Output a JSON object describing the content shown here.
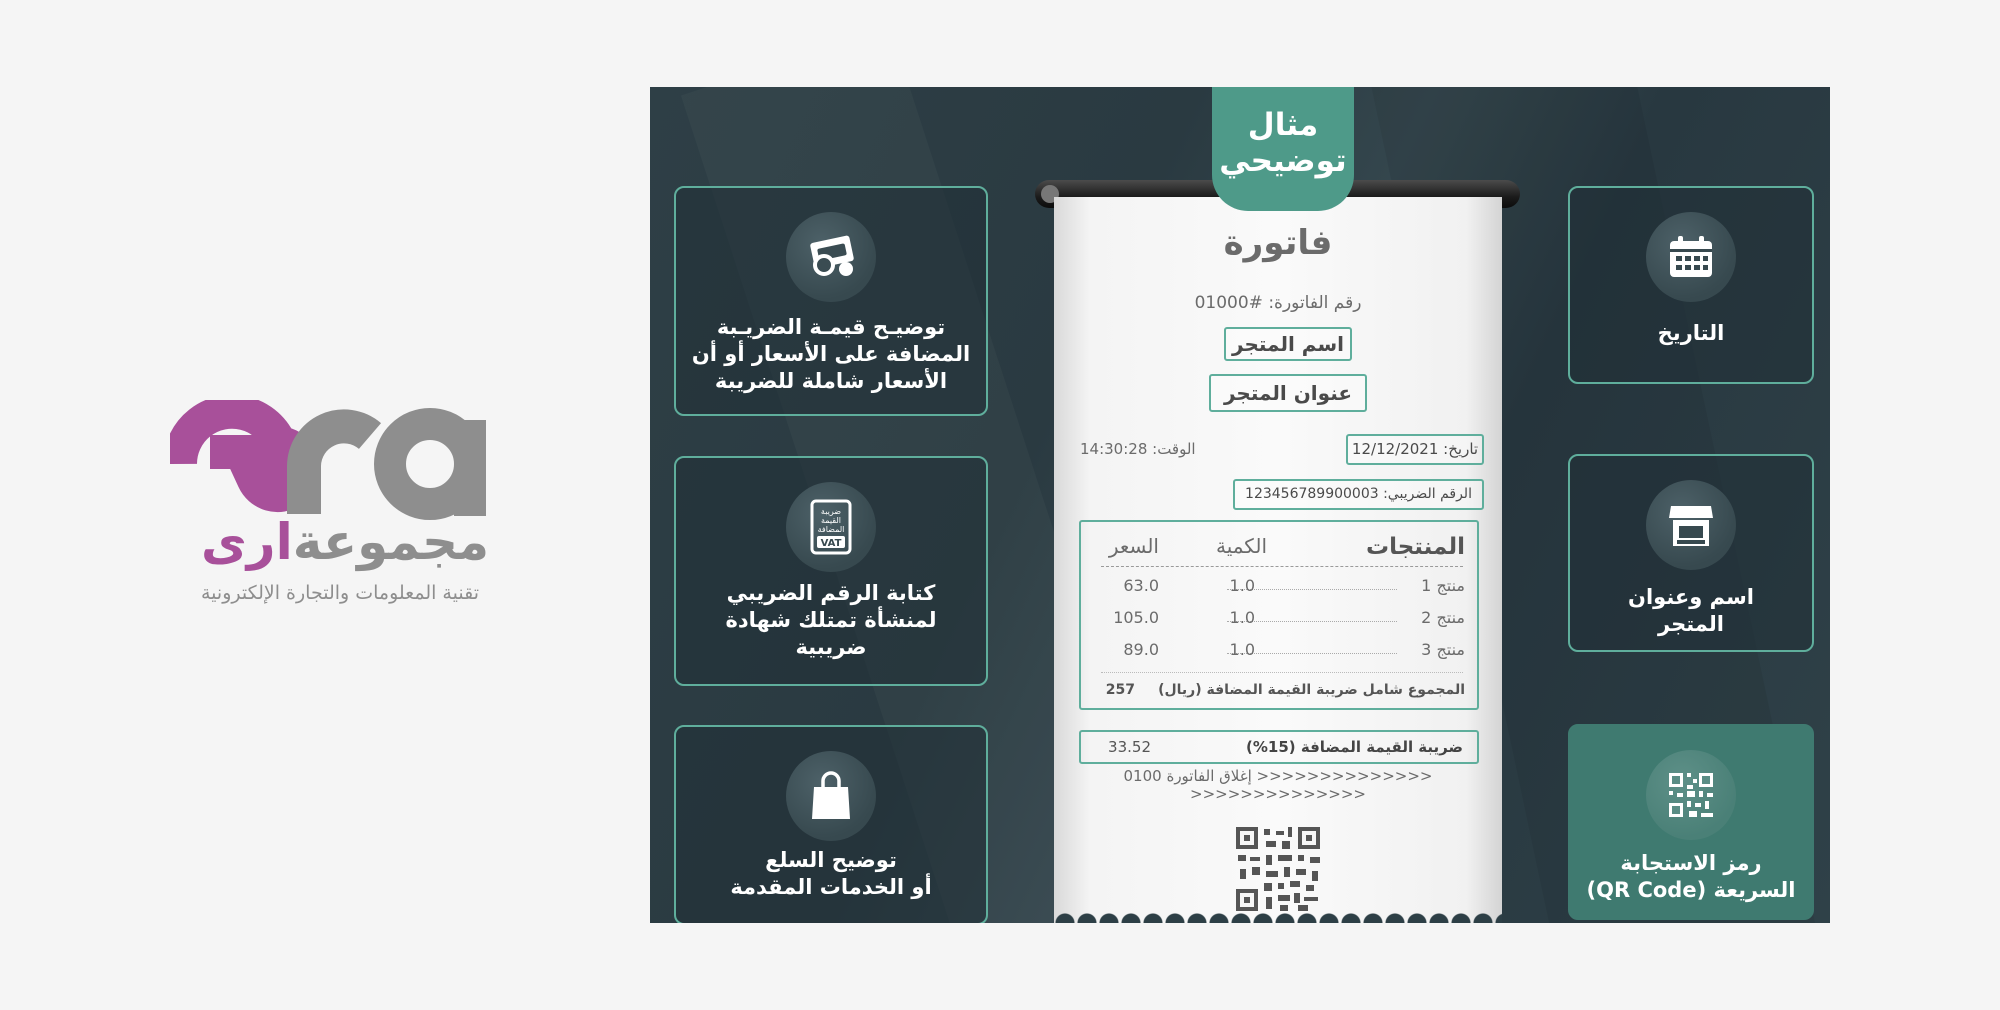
{
  "brand": {
    "latin": "era",
    "arabic_part1": "مجموعة",
    "arabic_part2": "ارى",
    "tagline": "تقنية المعلومات والتجارة الإلكترونية",
    "color_primary": "#a8509a",
    "color_secondary": "#8e8e8e"
  },
  "badge": {
    "line1": "مثال",
    "line2": "توضيحي"
  },
  "cards_left": [
    {
      "icon": "money-icon",
      "text_lines": [
        "توضيـح قيمـة الضريـبة",
        "المضافة على الأسعار أو أن",
        "الأسعار شاملة للضريبة"
      ]
    },
    {
      "icon": "vat-certificate-icon",
      "text_lines": [
        "كتابة الرقم الضريبي",
        "لمنشأة تمتلك شهادة",
        "ضريبية"
      ]
    },
    {
      "icon": "shopping-bag-icon",
      "text_lines": [
        "توضيح السلع",
        "أو الخدمات المقدمة"
      ]
    }
  ],
  "cards_right": [
    {
      "icon": "calendar-icon",
      "text_lines": [
        "التاريخ"
      ]
    },
    {
      "icon": "store-icon",
      "text_lines": [
        "اسم وعنوان",
        "المتجر"
      ]
    },
    {
      "icon": "qr-code-icon",
      "text_lines": [
        "رمز الاستجابة",
        "السريعة (QR Code)"
      ]
    }
  ],
  "vat_icon_text": {
    "line1": "ضريبة",
    "line2": "القيمة",
    "line3": "المضافة",
    "line4": "VAT"
  },
  "receipt": {
    "title": "فاتورة",
    "invoice_number": "رقم الفاتورة: #01000",
    "store_name": "اسم المتجر",
    "store_address": "عنوان المتجر",
    "date": "تاريخ: 12/12/2021",
    "time": "الوقت: 14:30:28",
    "tax_number": "الرقم الضريبي: 123456789900003",
    "table": {
      "headers": {
        "product": "المنتجات",
        "qty": "الكمية",
        "price": "السعر"
      },
      "rows": [
        {
          "name": "منتج 1",
          "qty": "1.0",
          "price": "63.0"
        },
        {
          "name": "منتج 2",
          "qty": "1.0",
          "price": "105.0"
        },
        {
          "name": "منتج 3",
          "qty": "1.0",
          "price": "89.0"
        }
      ],
      "total_label": "المجموع شامل ضريبة القيمة المضافة (ريال)",
      "total_value": "257"
    },
    "vat_label": "ضريبة القيمة المضافة (15%)",
    "vat_value": "33.52",
    "closing": "<<<<<<<<<<<<<< إغلاق الفاتورة 0100 <<<<<<<<<<<<<<"
  }
}
